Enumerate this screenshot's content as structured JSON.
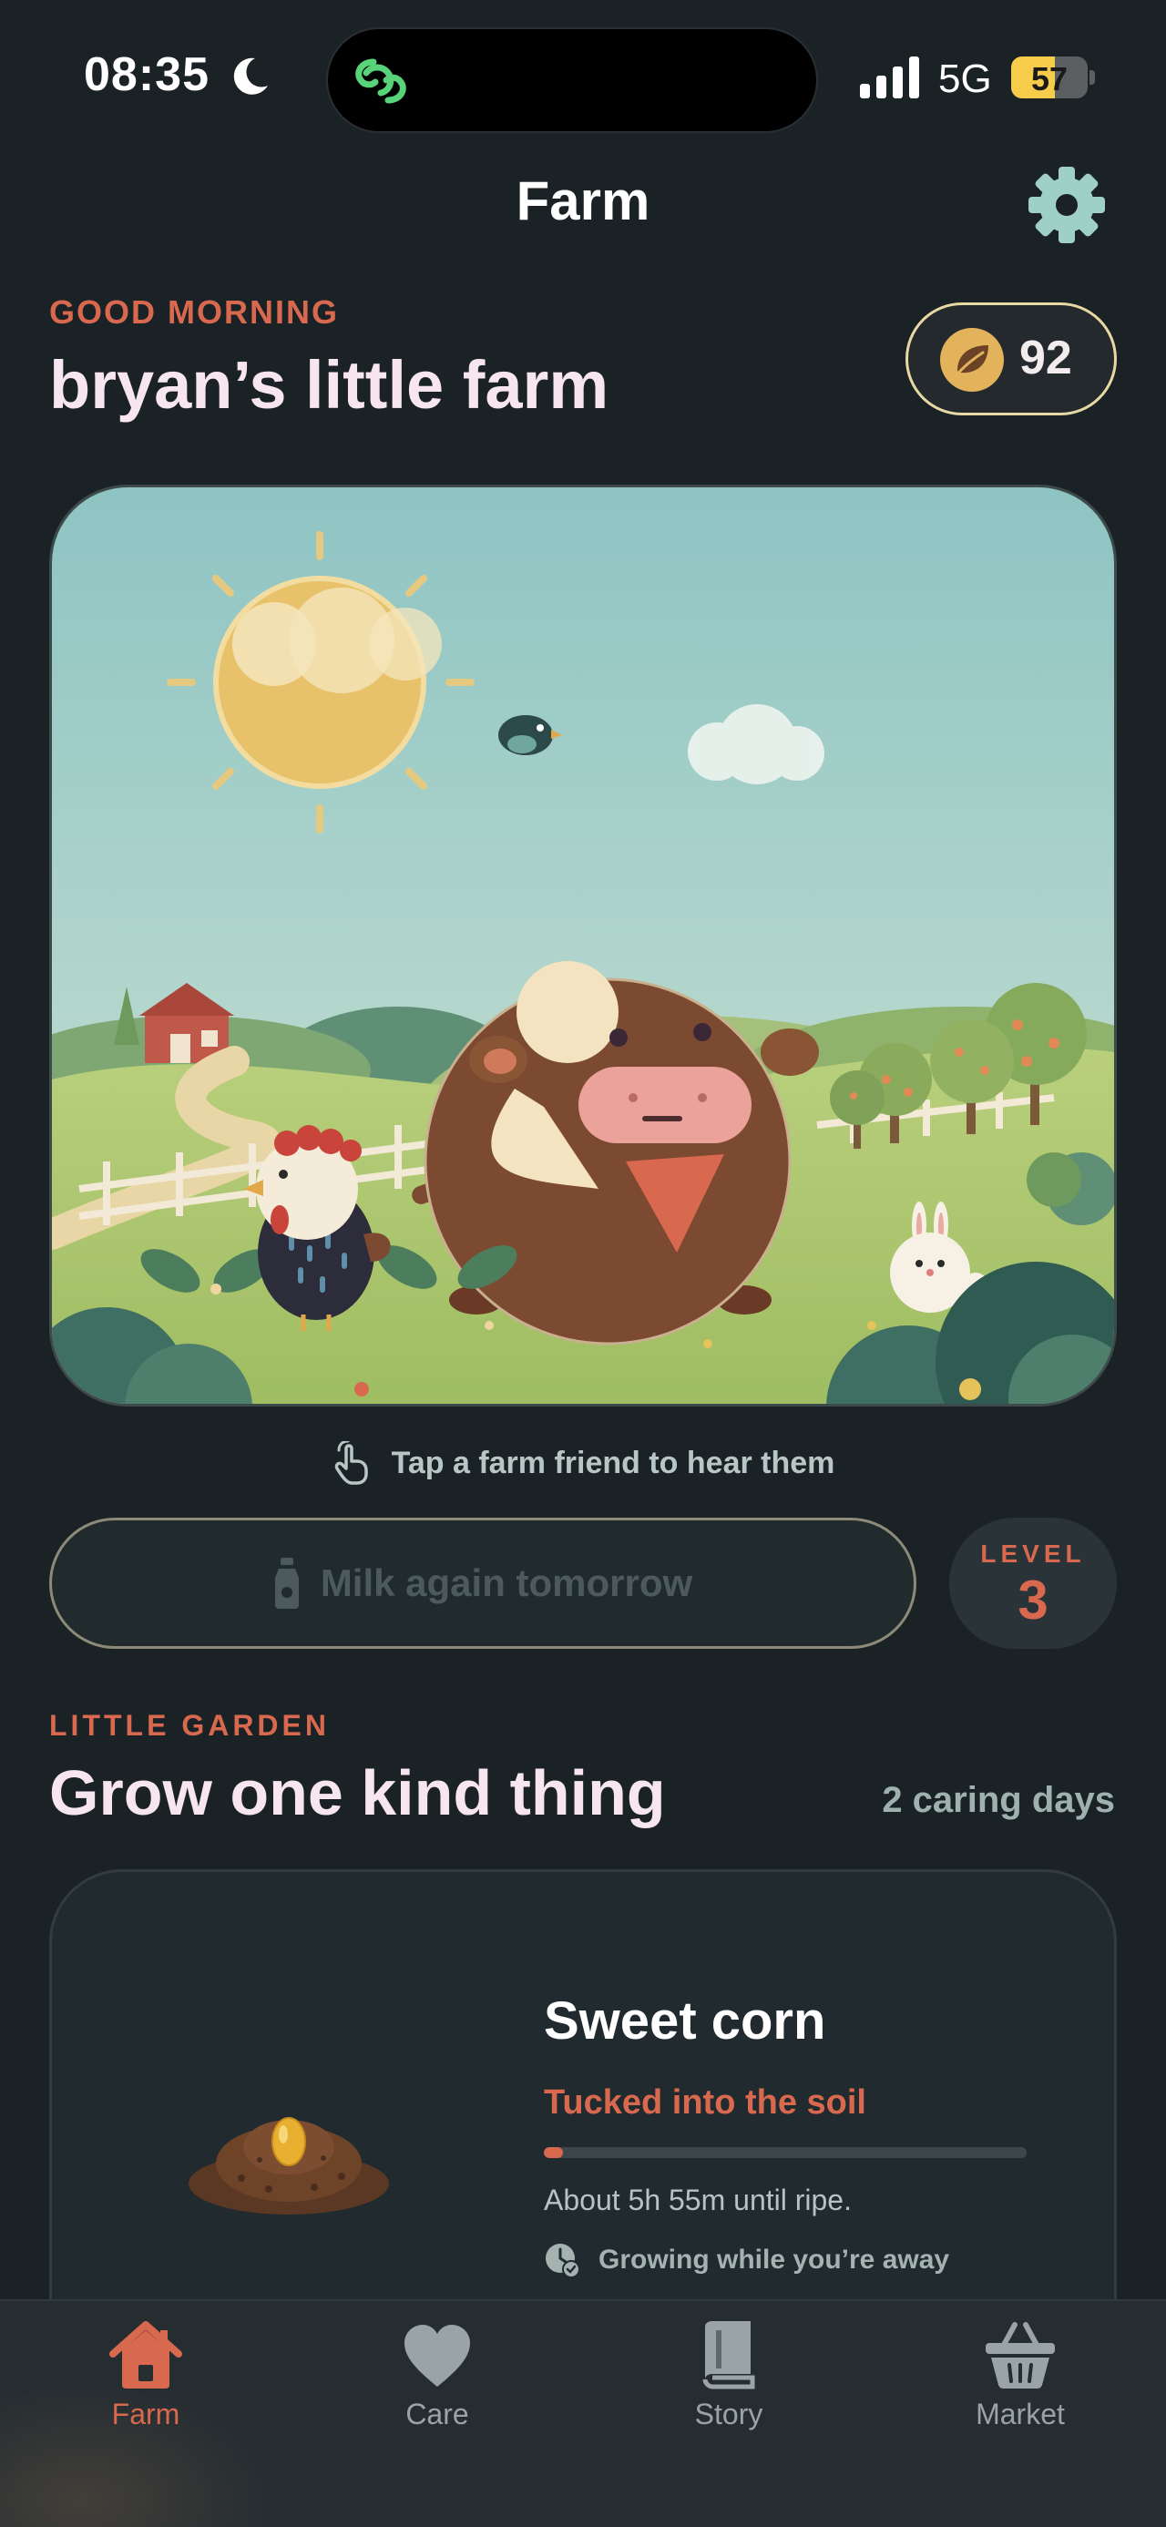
{
  "status_bar": {
    "time": "08:35",
    "network": "5G",
    "battery": "57",
    "battery_level_percent": 57
  },
  "header": {
    "title": "Farm",
    "greeting": "GOOD MORNING",
    "farm_name": "bryan’s little farm",
    "coin_balance": "92",
    "settings_icon": "gear-icon"
  },
  "scene": {
    "tap_hint": "Tap a farm friend to hear them"
  },
  "actions": {
    "milk_label": "Milk again tomorrow",
    "level_label": "LEVEL",
    "level_value": "3"
  },
  "garden": {
    "kicker": "LITTLE GARDEN",
    "title": "Grow one kind thing",
    "caring_days": "2 caring days",
    "crop": {
      "name": "Sweet corn",
      "stage": "Tucked into the soil",
      "progress_fraction": 0.04,
      "time_until_ripe": "About 5h 55m until ripe.",
      "note": "Growing while you’re away"
    }
  },
  "tabs": [
    {
      "label": "Farm",
      "icon": "house-icon",
      "active": true
    },
    {
      "label": "Care",
      "icon": "heart-icon",
      "active": false
    },
    {
      "label": "Story",
      "icon": "book-icon",
      "active": false
    },
    {
      "label": "Market",
      "icon": "basket-icon",
      "active": false
    }
  ],
  "colors": {
    "background": "#1b2226",
    "accent": "#d9694e",
    "coin_border": "#e8d9a4",
    "heading": "#f8e6ee",
    "muted": "#9fb1ae"
  }
}
